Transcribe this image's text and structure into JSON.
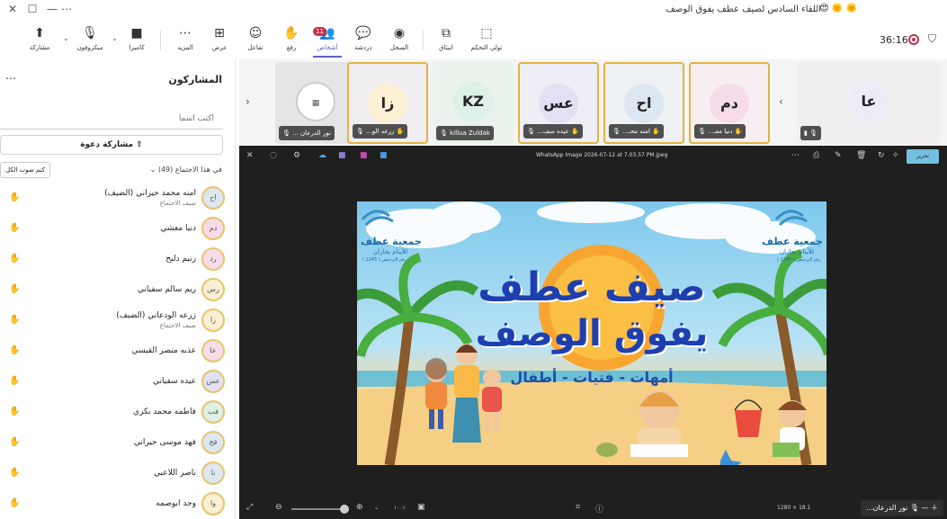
{
  "window": {
    "title": "اللقاء السادس لصيف عطف يفوق الوصف",
    "title_emojis": "😍 🌞 🌞",
    "controls": [
      "✕",
      "☐",
      "—",
      "⋯"
    ]
  },
  "toolbar": {
    "share": "مشاركة",
    "mic": "ميكروفون",
    "camera": "كاميرا",
    "more": "المزيد",
    "view": "عرض",
    "react": "تفاعل",
    "raise": "رفع",
    "people": "أشخاص",
    "people_badge": "11",
    "chat": "دردشة",
    "record": "السجل",
    "pop_out": "انبثاق",
    "take_control": "تولي التحكم",
    "timer": "36:16"
  },
  "sidebar": {
    "title": "المشاركون",
    "search_placeholder": "اكتب اسماً",
    "share_invite": "مشاركة دعوة",
    "section_label": "في هذا الاجتماع (49)",
    "mute_all": "كتم صوت الكل",
    "participants": [
      {
        "initials": "اح",
        "name": "امنه محمد حيراني (الضيف)",
        "sub": "ضيف الاجتماع",
        "color": "#dde7f2"
      },
      {
        "initials": "دم",
        "name": "دنيا معشي",
        "sub": "",
        "color": "#f6dbe8"
      },
      {
        "initials": "رد",
        "name": "رنيم دليح",
        "sub": "",
        "color": "#f6dbe8"
      },
      {
        "initials": "رس",
        "name": "ريم سالم سفياني",
        "sub": "",
        "color": "#fbefd4"
      },
      {
        "initials": "زا",
        "name": "زرعه الودعاني (الضيف)",
        "sub": "ضيف الاجتماع",
        "color": "#fbefd4"
      },
      {
        "initials": "عا",
        "name": "عذبه منصر القيسي",
        "sub": "",
        "color": "#f6dbe8"
      },
      {
        "initials": "عس",
        "name": "عيده سفياني",
        "sub": "",
        "color": "#e1e0f5"
      },
      {
        "initials": "فب",
        "name": "فاطمه محمد بكري",
        "sub": "",
        "color": "#dff1e6"
      },
      {
        "initials": "فج",
        "name": "فهد موسى حيراني",
        "sub": "",
        "color": "#dde7f2"
      },
      {
        "initials": "نا",
        "name": "ناصر اللاعبي",
        "sub": "",
        "color": "#dde7f2"
      },
      {
        "initials": "وا",
        "name": "وجد ابوصمه",
        "sub": "",
        "color": "#fbefd4"
      }
    ]
  },
  "strip": {
    "tiles": [
      {
        "initials": "",
        "name": "نور الدرعان ...",
        "bg": "#e5e5e5",
        "avatar_bg": "#ffffff",
        "highlight": false,
        "hand": false,
        "photo": true
      },
      {
        "initials": "زا",
        "name": "زرعه الو...",
        "bg": "#f1eef2",
        "avatar_bg": "#fbefd4",
        "highlight": true,
        "hand": true,
        "photo": false
      },
      {
        "initials": "KZ",
        "name": "killua Zuldak",
        "bg": "#eaf2ec",
        "avatar_bg": "#dff1e6",
        "highlight": false,
        "hand": false,
        "photo": false
      },
      {
        "initials": "عس",
        "name": "عيده سف...",
        "bg": "#eeeef7",
        "avatar_bg": "#e1e0f5",
        "highlight": true,
        "hand": true,
        "photo": false
      },
      {
        "initials": "اح",
        "name": "امنه محـ...",
        "bg": "#eef1f3",
        "avatar_bg": "#dde7f2",
        "highlight": true,
        "hand": true,
        "photo": false
      },
      {
        "initials": "دم",
        "name": "دنيا معـ...",
        "bg": "#f7eef1",
        "avatar_bg": "#f6dbe8",
        "highlight": true,
        "hand": true,
        "photo": false
      },
      {
        "initials": "عا",
        "name": "",
        "bg": "#f1eef2",
        "avatar_bg": "#ecebf6",
        "highlight": false,
        "hand": false,
        "photo": false
      }
    ]
  },
  "viewer": {
    "file_title": "WhatsApp Image 2026-07-12 at 7.03.57 PM.jpeg",
    "edit_label": "تحرير",
    "zoom_text": "١٠٠٪",
    "self_tile_name": "نور الدرعان...",
    "bottom_info": "1280 × 18.1"
  },
  "poster": {
    "org_name": "جمعية عطف",
    "org_sub": "للأيتام بجازان",
    "org_reg": "رقم الترخيص ( 1245 )",
    "headline_1": "صيف عطف",
    "headline_2": "يفوق الوصف",
    "tagline": "أمهات - فتيات - أطفال"
  }
}
